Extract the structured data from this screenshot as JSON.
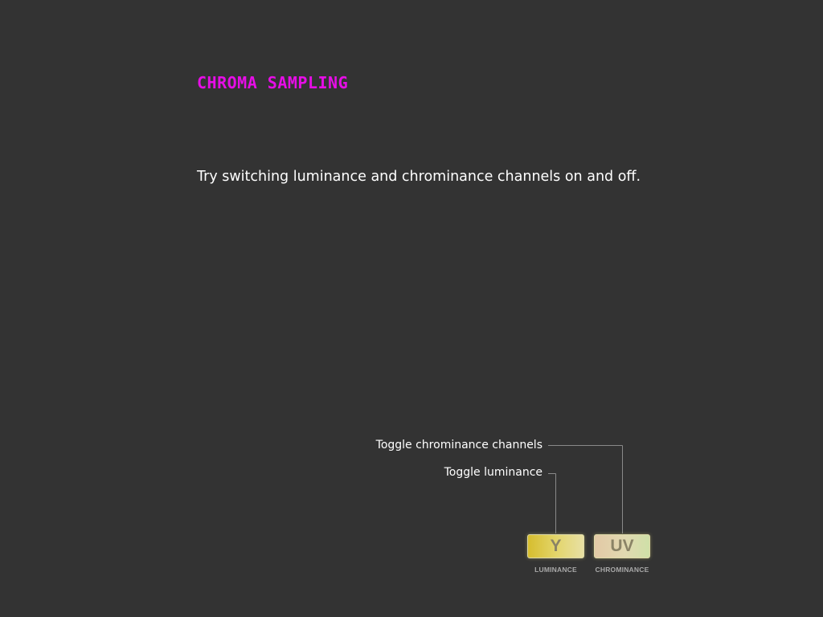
{
  "title": "CHROMA SAMPLING",
  "instruction": "Try switching luminance and chrominance channels on and off.",
  "callouts": {
    "chrominance": "Toggle chrominance channels",
    "luminance": "Toggle luminance"
  },
  "toggles": {
    "y": {
      "label": "Y",
      "caption": "LUMINANCE"
    },
    "uv": {
      "label": "UV",
      "caption": "CHROMINANCE"
    }
  },
  "colors": {
    "background": "#333333",
    "title": "#e60ee6",
    "text": "#ffffff",
    "leader_line": "#8a8a8a",
    "caption": "#a9a9a9"
  }
}
